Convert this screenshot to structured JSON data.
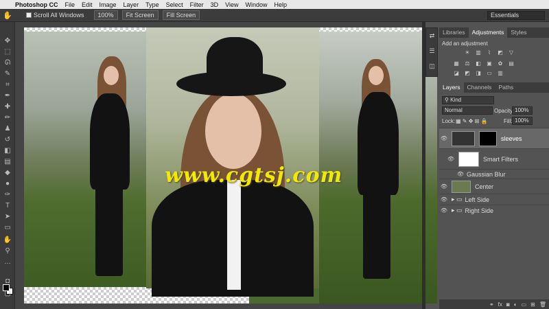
{
  "menubar": {
    "apple": "",
    "app_name": "Photoshop CC",
    "items": [
      "File",
      "Edit",
      "Image",
      "Layer",
      "Type",
      "Select",
      "Filter",
      "3D",
      "View",
      "Window",
      "Help"
    ]
  },
  "options": {
    "scroll_all": "Scroll All Windows",
    "zoom": "100%",
    "fit_screen": "Fit Screen",
    "fill_screen": "Fill Screen",
    "workspace": "Essentials"
  },
  "watermark": "www.cgtsj.com",
  "adjustments_panel": {
    "tabs": [
      "Libraries",
      "Adjustments",
      "Styles"
    ],
    "active_tab": "Adjustments",
    "heading": "Add an adjustment"
  },
  "layers_panel": {
    "tabs": [
      "Layers",
      "Channels",
      "Paths"
    ],
    "active_tab": "Layers",
    "filter": "Kind",
    "blend_mode": "Normal",
    "opacity_label": "Opacity:",
    "opacity": "100%",
    "lock_label": "Lock:",
    "fill_label": "Fill:",
    "fill": "100%",
    "layers": [
      {
        "name": "sleeves"
      },
      {
        "name": "Smart Filters"
      },
      {
        "name": "Gaussian Blur"
      },
      {
        "name": "Center"
      },
      {
        "name": "Left Side"
      },
      {
        "name": "Right Side"
      }
    ]
  },
  "colors": {
    "ui_dark": "#3c3c3c",
    "ui_panel": "#535353",
    "watermark": "#f2e800",
    "photo_grass": "#4a6b30"
  }
}
